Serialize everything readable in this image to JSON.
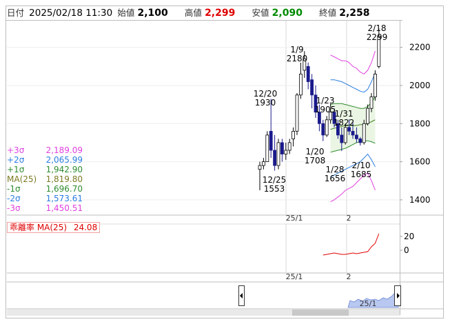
{
  "header": {
    "date_label": "日付",
    "datetime": "2025/02/18 11:30",
    "open_label": "始値",
    "open": "2,100",
    "high_label": "高値",
    "high": "2,299",
    "low_label": "安値",
    "low": "2,090",
    "close_label": "終値",
    "close": "2,258"
  },
  "colors": {
    "up_candle": "#ffffff",
    "down_candle": "#1a1a8c",
    "ma": "#3f7f1f",
    "sigma_plus3": "#e040e0",
    "sigma_plus2": "#2a7de0",
    "sigma_plus1": "#2e8b2e",
    "price_high": "#e00000",
    "price_low": "#008a00",
    "deviation": "#e00000"
  },
  "legend": [
    {
      "label": "+3σ",
      "value": "2,189.09",
      "color": "#e040e0"
    },
    {
      "label": "+2σ",
      "value": "2,065.99",
      "color": "#2a7de0"
    },
    {
      "label": "+1σ",
      "value": "1,942.90",
      "color": "#2e8b2e"
    },
    {
      "label": "MA(25)",
      "value": "1,819.80",
      "color": "#7a7a22"
    },
    {
      "label": "-1σ",
      "value": "1,696.70",
      "color": "#2e8b2e"
    },
    {
      "label": "-2σ",
      "value": "1,573.61",
      "color": "#2a7de0"
    },
    {
      "label": "-3σ",
      "value": "1,450.51",
      "color": "#e040e0"
    }
  ],
  "indicator": {
    "label": "乖離率 MA(25)",
    "value": "24.08",
    "y_ticks": [
      "20",
      "0"
    ]
  },
  "price_axis": {
    "ticks": [
      "2200",
      "2000",
      "1800",
      "1600",
      "1400"
    ]
  },
  "x_axis": {
    "labels": [
      "25/1",
      "2"
    ]
  },
  "navigator": {
    "label": "25/1"
  },
  "annotations": [
    {
      "date": "12/20",
      "price": "1930"
    },
    {
      "date": "1/9",
      "price": "2180"
    },
    {
      "date": "1/23",
      "price": "1905"
    },
    {
      "date": "1/31",
      "price": "1822"
    },
    {
      "date": "2/18",
      "price": "2299"
    },
    {
      "date": "12/25",
      "price": "1553"
    },
    {
      "date": "1/20",
      "price": "1708"
    },
    {
      "date": "1/28",
      "price": "1656"
    },
    {
      "date": "2/10",
      "price": "1685"
    }
  ],
  "chart_data": {
    "type": "candlestick",
    "price_range": [
      1400,
      2300
    ],
    "candles": [
      {
        "o": 1560,
        "h": 1600,
        "l": 1450,
        "c": 1580
      },
      {
        "o": 1580,
        "h": 1620,
        "l": 1560,
        "c": 1600
      },
      {
        "o": 1600,
        "h": 1760,
        "l": 1600,
        "c": 1740
      },
      {
        "o": 1760,
        "h": 1930,
        "l": 1620,
        "c": 1660
      },
      {
        "o": 1660,
        "h": 1740,
        "l": 1553,
        "c": 1580
      },
      {
        "o": 1580,
        "h": 1720,
        "l": 1560,
        "c": 1700
      },
      {
        "o": 1700,
        "h": 1720,
        "l": 1600,
        "c": 1640
      },
      {
        "o": 1640,
        "h": 1700,
        "l": 1610,
        "c": 1660
      },
      {
        "o": 1660,
        "h": 1720,
        "l": 1640,
        "c": 1700
      },
      {
        "o": 1720,
        "h": 1780,
        "l": 1680,
        "c": 1760
      },
      {
        "o": 1760,
        "h": 1960,
        "l": 1740,
        "c": 1950
      },
      {
        "o": 1950,
        "h": 2120,
        "l": 1930,
        "c": 2060
      },
      {
        "o": 2080,
        "h": 2180,
        "l": 2040,
        "c": 2140
      },
      {
        "o": 2100,
        "h": 2120,
        "l": 1980,
        "c": 2020
      },
      {
        "o": 2030,
        "h": 2060,
        "l": 1880,
        "c": 1950
      },
      {
        "o": 1950,
        "h": 2000,
        "l": 1830,
        "c": 1860
      },
      {
        "o": 1860,
        "h": 1900,
        "l": 1760,
        "c": 1800
      },
      {
        "o": 1800,
        "h": 1820,
        "l": 1708,
        "c": 1740
      },
      {
        "o": 1740,
        "h": 1840,
        "l": 1730,
        "c": 1820
      },
      {
        "o": 1820,
        "h": 1905,
        "l": 1800,
        "c": 1860
      },
      {
        "o": 1860,
        "h": 1880,
        "l": 1780,
        "c": 1800
      },
      {
        "o": 1800,
        "h": 1820,
        "l": 1720,
        "c": 1740
      },
      {
        "o": 1740,
        "h": 1780,
        "l": 1656,
        "c": 1700
      },
      {
        "o": 1700,
        "h": 1800,
        "l": 1690,
        "c": 1780
      },
      {
        "o": 1780,
        "h": 1822,
        "l": 1740,
        "c": 1760
      },
      {
        "o": 1760,
        "h": 1810,
        "l": 1720,
        "c": 1740
      },
      {
        "o": 1740,
        "h": 1780,
        "l": 1700,
        "c": 1720
      },
      {
        "o": 1720,
        "h": 1730,
        "l": 1685,
        "c": 1700
      },
      {
        "o": 1700,
        "h": 1820,
        "l": 1690,
        "c": 1800
      },
      {
        "o": 1800,
        "h": 1900,
        "l": 1790,
        "c": 1880
      },
      {
        "o": 1880,
        "h": 1960,
        "l": 1860,
        "c": 1940
      },
      {
        "o": 1940,
        "h": 2080,
        "l": 1920,
        "c": 2060
      },
      {
        "o": 2100,
        "h": 2299,
        "l": 2090,
        "c": 2258
      }
    ],
    "bands_start_index": 19,
    "plus3": [
      2160,
      2150,
      2140,
      2130,
      2130,
      2120,
      2100,
      2090,
      2070,
      2060,
      2080,
      2120,
      2180
    ],
    "plus2": [
      2030,
      2030,
      2025,
      2020,
      2010,
      2000,
      1990,
      1980,
      1970,
      1965,
      1980,
      2020,
      2066
    ],
    "plus1": [
      1900,
      1905,
      1905,
      1905,
      1900,
      1895,
      1890,
      1885,
      1880,
      1880,
      1890,
      1910,
      1943
    ],
    "ma": [
      1770,
      1775,
      1780,
      1785,
      1790,
      1790,
      1790,
      1790,
      1795,
      1795,
      1800,
      1810,
      1820
    ],
    "minus1": [
      1650,
      1655,
      1660,
      1665,
      1670,
      1680,
      1690,
      1700,
      1705,
      1710,
      1710,
      1705,
      1697
    ],
    "minus2": [
      1520,
      1530,
      1540,
      1550,
      1560,
      1570,
      1580,
      1590,
      1600,
      1620,
      1640,
      1610,
      1574
    ],
    "minus3": [
      1390,
      1400,
      1415,
      1430,
      1450,
      1460,
      1470,
      1490,
      1510,
      1530,
      1540,
      1500,
      1451
    ],
    "deviation": [
      -7,
      -6,
      -5,
      -4,
      -5,
      -6,
      -6,
      -5,
      -4,
      -5,
      -4,
      -3,
      -2,
      5,
      10,
      24
    ]
  }
}
